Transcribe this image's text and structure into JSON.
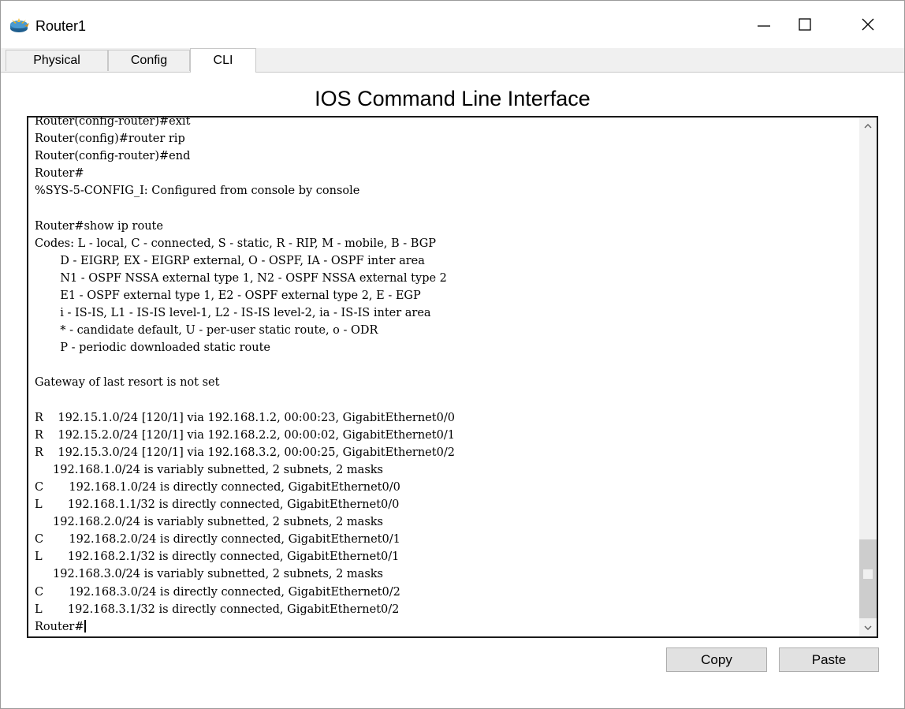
{
  "window": {
    "title": "Router1"
  },
  "tabs": [
    {
      "label": "Physical"
    },
    {
      "label": "Config"
    },
    {
      "label": "CLI"
    }
  ],
  "active_tab": "CLI",
  "panel": {
    "title": "IOS Command Line Interface"
  },
  "terminal": {
    "lines": [
      "Router(config-router)#exit",
      "Router(config)#router rip",
      "Router(config-router)#end",
      "Router#",
      "%SYS-5-CONFIG_I: Configured from console by console",
      "",
      "Router#show ip route",
      "Codes: L - local, C - connected, S - static, R - RIP, M - mobile, B - BGP",
      "       D - EIGRP, EX - EIGRP external, O - OSPF, IA - OSPF inter area",
      "       N1 - OSPF NSSA external type 1, N2 - OSPF NSSA external type 2",
      "       E1 - OSPF external type 1, E2 - OSPF external type 2, E - EGP",
      "       i - IS-IS, L1 - IS-IS level-1, L2 - IS-IS level-2, ia - IS-IS inter area",
      "       * - candidate default, U - per-user static route, o - ODR",
      "       P - periodic downloaded static route",
      "",
      "Gateway of last resort is not set",
      "",
      "R    192.15.1.0/24 [120/1] via 192.168.1.2, 00:00:23, GigabitEthernet0/0",
      "R    192.15.2.0/24 [120/1] via 192.168.2.2, 00:00:02, GigabitEthernet0/1",
      "R    192.15.3.0/24 [120/1] via 192.168.3.2, 00:00:25, GigabitEthernet0/2",
      "     192.168.1.0/24 is variably subnetted, 2 subnets, 2 masks",
      "C       192.168.1.0/24 is directly connected, GigabitEthernet0/0",
      "L       192.168.1.1/32 is directly connected, GigabitEthernet0/0",
      "     192.168.2.0/24 is variably subnetted, 2 subnets, 2 masks",
      "C       192.168.2.0/24 is directly connected, GigabitEthernet0/1",
      "L       192.168.2.1/32 is directly connected, GigabitEthernet0/1",
      "     192.168.3.0/24 is variably subnetted, 2 subnets, 2 masks",
      "C       192.168.3.0/24 is directly connected, GigabitEthernet0/2",
      "L       192.168.3.1/32 is directly connected, GigabitEthernet0/2"
    ],
    "prompt": "Router#"
  },
  "buttons": {
    "copy": "Copy",
    "paste": "Paste"
  },
  "icons": {
    "app": "router-icon",
    "minimize": "minimize-icon",
    "maximize": "maximize-icon",
    "close": "close-icon",
    "scroll_up": "chevron-up-icon",
    "scroll_down": "chevron-down-icon"
  }
}
